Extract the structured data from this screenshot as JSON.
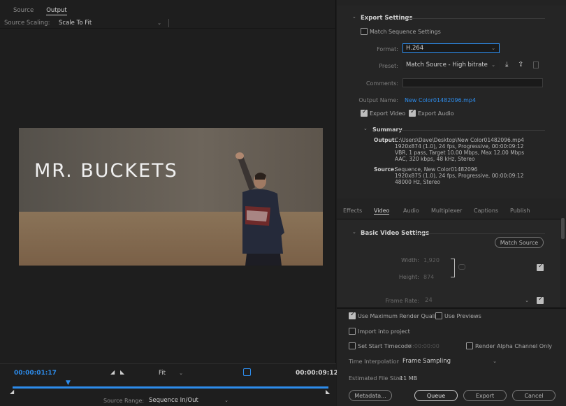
{
  "source_panel": {
    "tabs": [
      {
        "label": "Source"
      },
      {
        "label": "Output"
      }
    ],
    "scaling_label": "Source Scaling:",
    "scaling_value": "Scale To Fit",
    "preview_title": "MR. BUCKETS",
    "timecode_current": "00:00:01:17",
    "timecode_end": "00:00:09:12",
    "zoom_value": "Fit",
    "source_range_label": "Source Range:",
    "source_range_value": "Sequence In/Out"
  },
  "export_settings": {
    "section_title": "Export Settings",
    "match_sequence_label": "Match Sequence Settings",
    "format_label": "Format:",
    "format_value": "H.264",
    "preset_label": "Preset:",
    "preset_value": "Match Source - High bitrate",
    "comments_label": "Comments:",
    "comments_value": "",
    "output_name_label": "Output Name:",
    "output_name_value": "New Color01482096.mp4",
    "export_video_label": "Export Video",
    "export_audio_label": "Export Audio",
    "summary_title": "Summary",
    "summary_output_label": "Output:",
    "summary_output_lines": [
      "C:\\Users\\Dave\\Desktop\\New Color01482096.mp4",
      "1920x874 (1.0), 24 fps, Progressive, 00:00:09:12",
      "VBR, 1 pass, Target 10.00 Mbps, Max 12.00 Mbps",
      "AAC, 320 kbps, 48 kHz, Stereo"
    ],
    "summary_source_label": "Source:",
    "summary_source_lines": [
      "Sequence, New Color01482096",
      "1920x875 (1.0), 24 fps, Progressive, 00:00:09:12",
      "48000 Hz, Stereo"
    ]
  },
  "panel_tabs": [
    {
      "label": "Effects"
    },
    {
      "label": "Video"
    },
    {
      "label": "Audio"
    },
    {
      "label": "Multiplexer"
    },
    {
      "label": "Captions"
    },
    {
      "label": "Publish"
    }
  ],
  "video_settings": {
    "section_title": "Basic Video Settings",
    "match_source_label": "Match Source",
    "width_label": "Width:",
    "width_value": "1,920",
    "height_label": "Height:",
    "height_value": "874",
    "frame_rate_label": "Frame Rate:",
    "frame_rate_value": "24"
  },
  "bottom_options": {
    "max_render_label": "Use Maximum Render Quality",
    "use_previews_label": "Use Previews",
    "import_label": "Import into project",
    "start_timecode_label": "Set Start Timecode",
    "start_timecode_value": "00:00:00:00",
    "render_alpha_label": "Render Alpha Channel Only",
    "time_interp_label": "Time Interpolation:",
    "time_interp_value": "Frame Sampling",
    "file_size_label": "Estimated File Size:",
    "file_size_value": "11 MB"
  },
  "buttons": {
    "metadata": "Metadata...",
    "queue": "Queue",
    "export": "Export",
    "cancel": "Cancel"
  },
  "colors": {
    "accent": "#2d8ceb",
    "panel": "#232323"
  }
}
